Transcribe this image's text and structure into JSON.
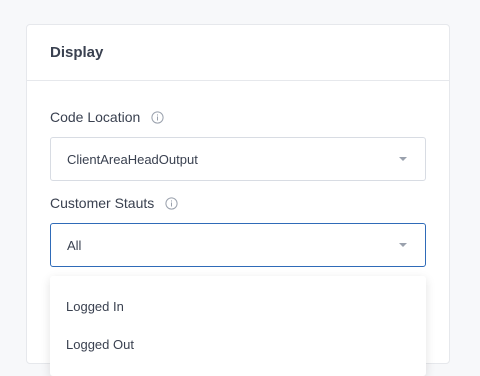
{
  "panel": {
    "title": "Display"
  },
  "code_location": {
    "label": "Code Location",
    "value": "ClientAreaHeadOutput"
  },
  "customer_status": {
    "label": "Customer Stauts",
    "value": "All",
    "options": [
      "Logged In",
      "Logged Out"
    ]
  },
  "colors": {
    "accent": "#2f6bb8",
    "border": "#d8dce3",
    "text": "#3a4150"
  }
}
